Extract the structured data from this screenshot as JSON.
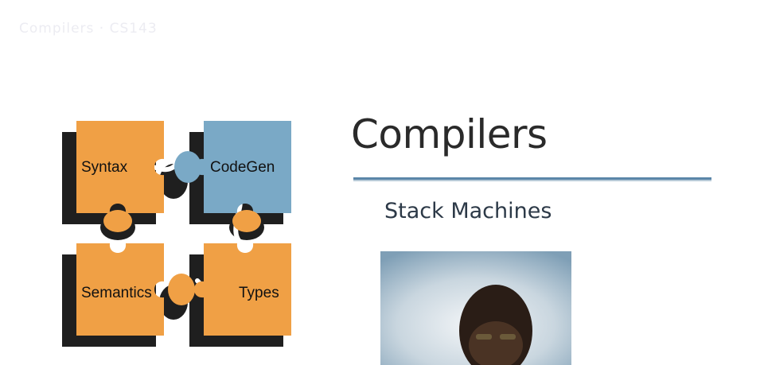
{
  "header": {
    "faded_text": "Compilers · CS143"
  },
  "puzzle": {
    "pieces": {
      "syntax": "Syntax",
      "codegen": "CodeGen",
      "semantics": "Semantics",
      "types": "Types"
    },
    "colors": {
      "orange": "#f0a045",
      "blue": "#7aa9c6",
      "shadow": "#1f1f1f"
    }
  },
  "slide": {
    "title": "Compilers",
    "subtitle": "Stack Machines",
    "rule_color": "#5a86a8"
  },
  "video": {
    "icon": "presenter-webcam"
  }
}
